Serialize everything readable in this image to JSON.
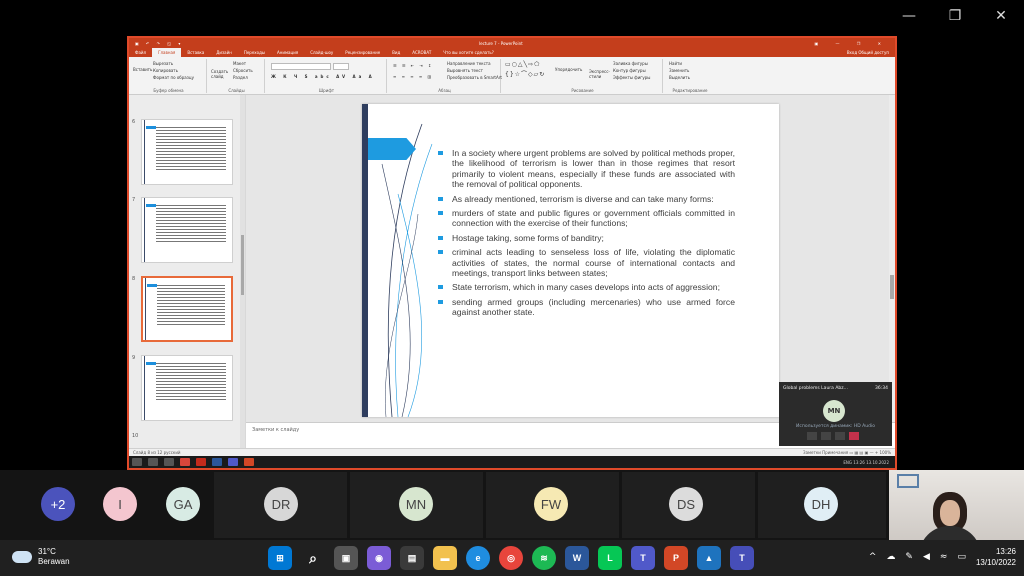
{
  "window": {
    "title": "lecture 7 - PowerPoint",
    "controls": [
      "—",
      "❐",
      "✕"
    ]
  },
  "ppt": {
    "quick_access": "▣ ↶ ↷ ◱ ▾",
    "title": "lecture 7 - PowerPoint",
    "window_ctl": "▣ — ❐ ✕",
    "tabs": [
      "Файл",
      "Главная",
      "Вставка",
      "Дизайн",
      "Переходы",
      "Анимация",
      "Слайд-шоу",
      "Рецензирование",
      "Вид",
      "ACROBAT",
      "Что вы хотите сделать?"
    ],
    "account": "Вход  Общий доступ",
    "ribbon": {
      "paste": "Вставить",
      "cut": "Вырезать",
      "copy": "Копировать",
      "format_painter": "Формат по образцу",
      "clipboard_group": "Буфер обмена",
      "new_slide": "Создать слайд",
      "layout": "Макет",
      "reset": "Сбросить",
      "section": "Раздел",
      "slides_group": "Слайды",
      "font_group": "Шрифт",
      "text_direction": "Направление текста",
      "align_text": "Выровнять текст",
      "smartart": "Преобразовать в SmartArt",
      "paragraph_group": "Абзац",
      "arrange": "Упорядочить",
      "quick_styles": "Экспресс-стили",
      "shape_fill": "Заливка фигуры",
      "shape_outline": "Контур фигуры",
      "shape_effects": "Эффекты фигуры",
      "drawing_group": "Рисование",
      "find": "Найти",
      "replace": "Заменить",
      "select": "Выделить",
      "editing_group": "Редактирование"
    },
    "thumbnails": [
      "6",
      "7",
      "8",
      "9",
      "10"
    ],
    "slide_bullets": [
      "In a society where urgent problems are solved by political methods proper, the likelihood of terrorism is lower than in those regimes that resort primarily to violent means, especially if these funds are associated with the removal of political opponents.",
      "As already mentioned, terrorism is diverse and can take many forms:",
      "murders of state and public figures or government officials committed in connection with the exercise of their functions;",
      " Hostage taking, some forms of banditry;",
      "criminal acts leading to senseless loss of life, violating the diplomatic activities of states, the normal course of international contacts and meetings, transport links between states;",
      "State terrorism, which in many cases develops into acts of aggression;",
      "sending armed groups (including mercenaries) who use armed force against another state."
    ],
    "notes_placeholder": "Заметки к слайду",
    "status_left": "Слайд 8 из 12   русский",
    "status_right": "Заметки   Примечания   ▭ ▦ ▤ ▣   —  +  100%",
    "inner_taskbar_right": "ENG  13:26  13.10.2022"
  },
  "float_video": {
    "title": "Global problems Laura Abz...",
    "time": "36:34",
    "initials": "MN",
    "subtitle": "Используется динамик: HD Audio"
  },
  "participants": [
    {
      "initials": "+2",
      "bg": "#4b53bc",
      "fg": "#ffffff"
    },
    {
      "initials": "I",
      "bg": "#f4c6cf",
      "fg": "#444444"
    },
    {
      "initials": "GA",
      "bg": "#d8ebe4",
      "fg": "#444444"
    },
    {
      "initials": "DR",
      "bg": "#d7d7d7",
      "fg": "#444444"
    },
    {
      "initials": "MN",
      "bg": "#d7e6cf",
      "fg": "#444444"
    },
    {
      "initials": "FW",
      "bg": "#f6e9b3",
      "fg": "#444444"
    },
    {
      "initials": "DS",
      "bg": "#dcdcdc",
      "fg": "#444444"
    },
    {
      "initials": "DH",
      "bg": "#e0eef5",
      "fg": "#444444"
    }
  ],
  "weather": {
    "temp": "31°C",
    "desc": "Berawan"
  },
  "taskbar_apps": [
    "windows-icon",
    "search-icon",
    "task-view-icon",
    "teams-chat-icon",
    "file-explorer-icon",
    "folder-icon",
    "edge-icon",
    "chrome-icon",
    "spotify-icon",
    "word-icon",
    "line-icon",
    "teams-icon",
    "powerpoint-icon",
    "photos-icon",
    "teams-active-icon"
  ],
  "clock": {
    "time": "13:26",
    "date": "13/10/2022"
  },
  "colors": {
    "ppt_accent": "#c43e1c",
    "bullet_blue": "#1e9be0",
    "slide_stripe": "#2e3d5e"
  }
}
